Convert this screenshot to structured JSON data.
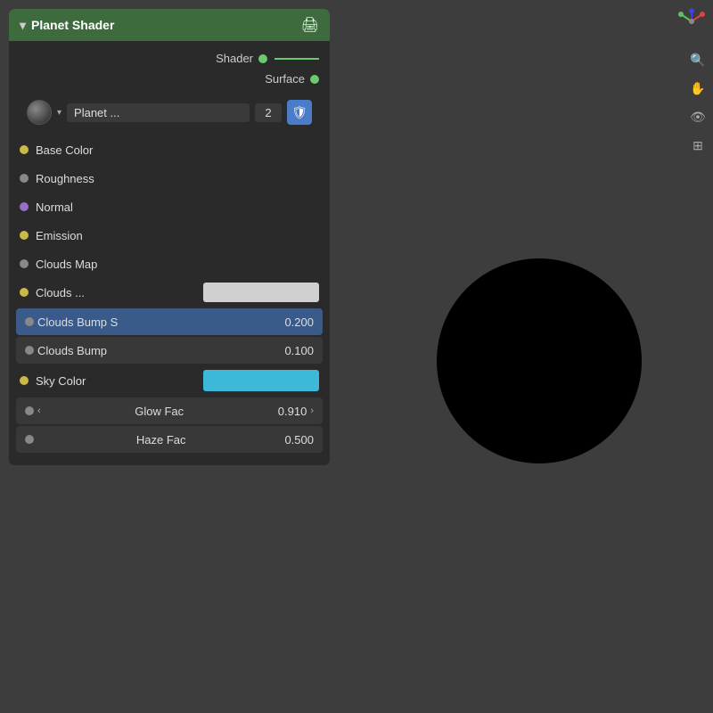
{
  "panel": {
    "title": "Planet Shader",
    "expand_label": "▾",
    "shader_label": "Shader",
    "surface_label": "Surface",
    "material": {
      "name": "Planet ...",
      "number": "2"
    },
    "properties": [
      {
        "id": "base-color",
        "label": "Base Color",
        "dot": "yellow"
      },
      {
        "id": "roughness",
        "label": "Roughness",
        "dot": "gray"
      },
      {
        "id": "normal",
        "label": "Normal",
        "dot": "purple"
      },
      {
        "id": "emission",
        "label": "Emission",
        "dot": "yellow"
      },
      {
        "id": "clouds-map",
        "label": "Clouds Map",
        "dot": "gray"
      }
    ],
    "clouds_label": "Clouds ...",
    "clouds_bump_s": {
      "label": "Clouds Bump S",
      "value": "0.200"
    },
    "clouds_bump": {
      "label": "Clouds Bump",
      "value": "0.100"
    },
    "sky_color_label": "Sky Color",
    "glow": {
      "label": "Glow Fac",
      "value": "0.910"
    },
    "haze": {
      "label": "Haze Fac",
      "value": "0.500"
    }
  },
  "toolbar": {
    "items": [
      "axes",
      "search",
      "hand",
      "camera",
      "grid"
    ]
  },
  "colors": {
    "dot_green": "#6dc96d",
    "dot_yellow": "#c9b84a",
    "dot_gray": "#888888",
    "dot_purple": "#9b6dc9",
    "header_bg": "#3d6b3d",
    "slider_blue_bg": "#3a5a8a",
    "sky_color": "#3db8d8",
    "clouds_color": "#d0d0d0",
    "shield_blue": "#4a7cc7"
  }
}
